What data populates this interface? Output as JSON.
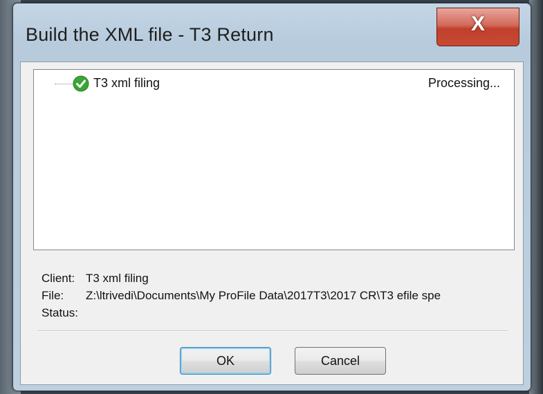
{
  "window": {
    "title": "Build the XML file - T3 Return",
    "close_label": "X"
  },
  "tree": {
    "items": [
      {
        "name": "T3 xml filing",
        "status": "Processing...",
        "icon": "check-icon",
        "icon_color": "#3aa634"
      }
    ]
  },
  "info": {
    "client_label": "Client:",
    "client_value": "T3 xml filing",
    "file_label": "File:",
    "file_value": "Z:\\ltrivedi\\Documents\\My ProFile Data\\2017T3\\2017 CR\\T3 efile spe",
    "status_label": "Status:",
    "status_value": ""
  },
  "buttons": {
    "ok_label": "OK",
    "cancel_label": "Cancel"
  }
}
